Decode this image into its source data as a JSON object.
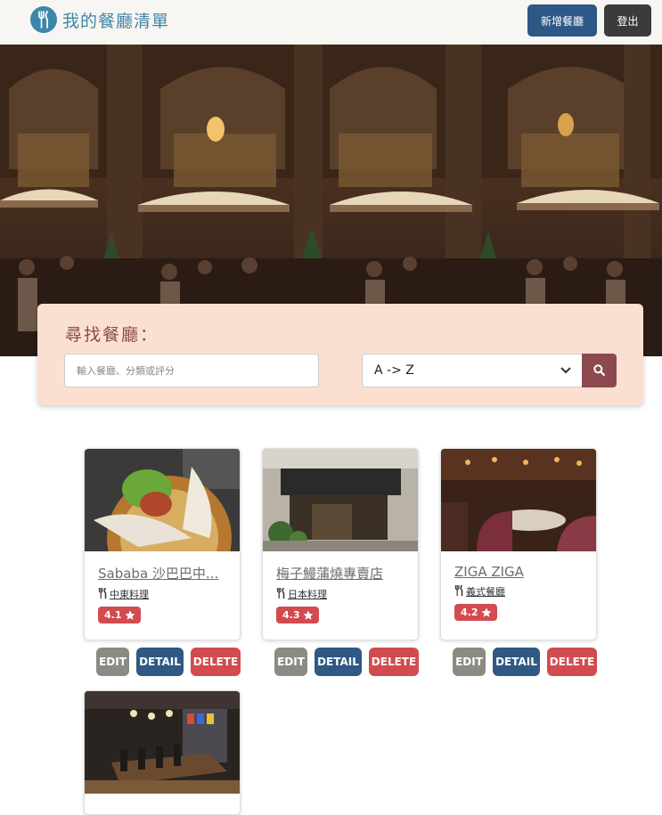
{
  "header": {
    "brand": "我的餐廳清單",
    "new_button": "新增餐廳",
    "logout_button": "登出"
  },
  "search": {
    "title": "尋找餐廳：",
    "placeholder": "輸入餐廳、分類或評分",
    "sort_value": "A -> Z"
  },
  "restaurants": [
    {
      "name": "Sababa 沙巴巴中...",
      "category": "中東料理",
      "rating": "4.1"
    },
    {
      "name": "梅子鰻蒲燒專賣店",
      "category": "日本料理",
      "rating": "4.3"
    },
    {
      "name": "ZIGA ZIGA",
      "category": "義式餐廳",
      "rating": "4.2"
    }
  ],
  "actions": {
    "edit": "EDIT",
    "detail": "DETAIL",
    "delete": "DELETE"
  },
  "colors": {
    "brand": "#3e86a8",
    "primary": "#2d5886",
    "danger": "#d24b4e",
    "search_bg": "#fbe0d2"
  }
}
